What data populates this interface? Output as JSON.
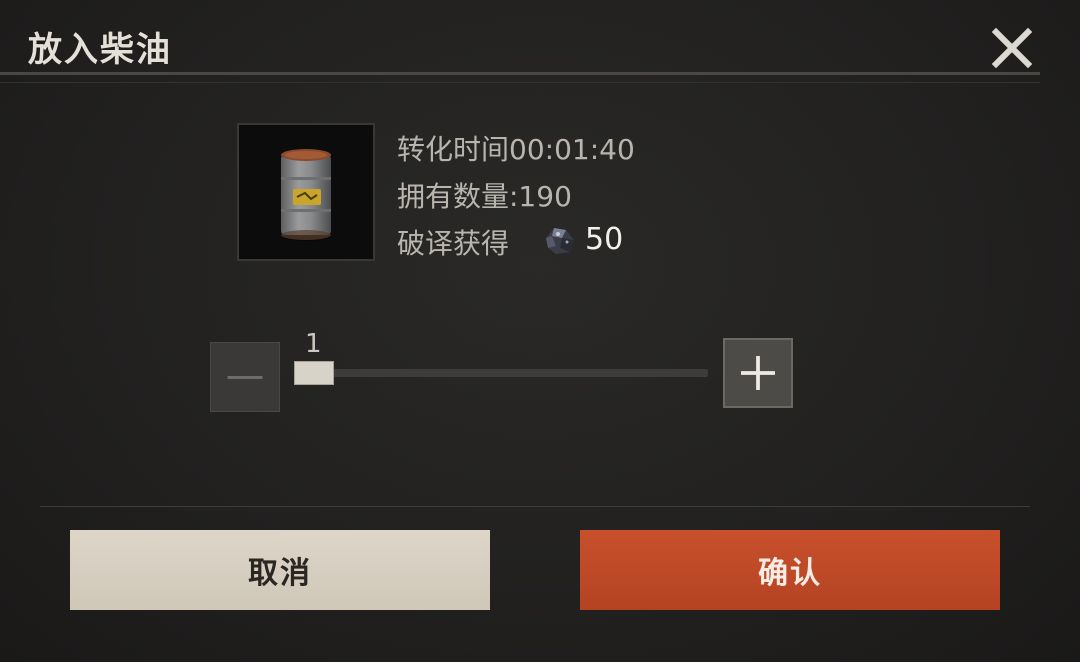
{
  "dialog": {
    "title": "放入柴油",
    "close_icon": "close-icon"
  },
  "item": {
    "icon": "oil-barrel-icon",
    "conversion_time": "转化时间00:01:40",
    "owned_count": "拥有数量:190",
    "reward_label": "破译获得",
    "reward_icon": "ore-chunk-icon",
    "reward_amount": "50"
  },
  "quantity": {
    "value": "1",
    "min_fraction": 0.0,
    "minus_icon": "minus-icon",
    "plus_icon": "plus-icon"
  },
  "buttons": {
    "cancel_label": "取消",
    "confirm_label": "确认"
  },
  "colors": {
    "confirm_accent": "#c04a28",
    "cancel_bg": "#d8d1c3",
    "panel_bg": "#232220"
  }
}
